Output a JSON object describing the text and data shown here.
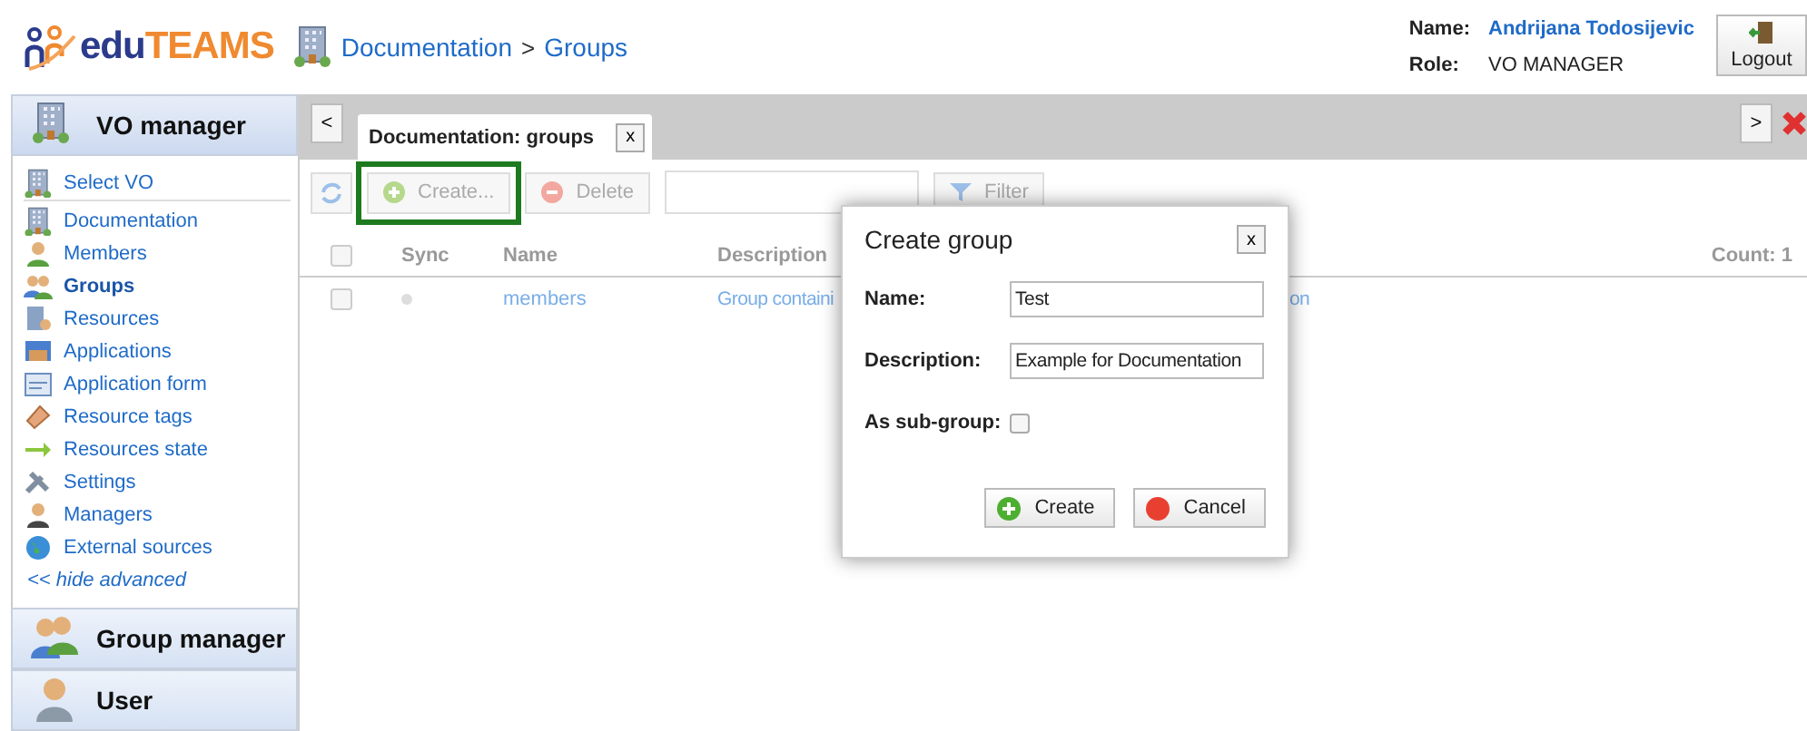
{
  "header": {
    "logo": {
      "part_1": "edu",
      "part_2": "TEAMS"
    },
    "breadcrumb": {
      "items": [
        "Documentation",
        "Groups"
      ],
      "separator": ">"
    },
    "user": {
      "name_label": "Name:",
      "name": "Andrijana Todosijevic",
      "role_label": "Role:",
      "role": "VO MANAGER"
    },
    "logout": "Logout"
  },
  "sidebar": {
    "sections": [
      {
        "title": "VO manager",
        "expanded": true,
        "items": [
          {
            "label": "Select VO",
            "selected": false
          },
          {
            "label": "Documentation",
            "selected": false
          },
          {
            "label": "Members",
            "selected": false
          },
          {
            "label": "Groups",
            "selected": true
          },
          {
            "label": "Resources",
            "selected": false
          },
          {
            "label": "Applications",
            "selected": false
          },
          {
            "label": "Application form",
            "selected": false
          },
          {
            "label": "Resource tags",
            "selected": false
          },
          {
            "label": "Resources state",
            "selected": false
          },
          {
            "label": "Settings",
            "selected": false
          },
          {
            "label": "Managers",
            "selected": false
          },
          {
            "label": "External sources",
            "selected": false
          }
        ],
        "toggle_link": "<< hide advanced"
      },
      {
        "title": "Group manager",
        "expanded": false
      },
      {
        "title": "User",
        "expanded": false
      }
    ]
  },
  "tab_bar": {
    "prev": "<",
    "next": ">",
    "tabs": [
      {
        "label": "Documentation: groups",
        "selected": true,
        "close": "x"
      }
    ]
  },
  "toolbar": {
    "create": {
      "label": "Create...",
      "highlighted": true
    },
    "delete": {
      "label": "Delete"
    },
    "filter": {
      "label": "Filter"
    }
  },
  "table": {
    "header_checked": false,
    "columns": [
      "Sync",
      "Name",
      "Description"
    ],
    "count": "Count: 1",
    "rows": [
      {
        "checked": false,
        "name": "members",
        "description": "Group containi",
        "description_tail": "on"
      }
    ]
  },
  "dialog": {
    "title": "Create group",
    "close": "x",
    "fields": [
      {
        "kind": "text",
        "label": "Name:",
        "value": "Test"
      },
      {
        "kind": "text",
        "label": "Description:",
        "value": "Example for Documentation"
      },
      {
        "kind": "checkbox",
        "label": "As sub-group:",
        "checked": false
      }
    ],
    "buttons": [
      {
        "kind": "create",
        "label": "Create"
      },
      {
        "kind": "cancel",
        "label": "Cancel"
      }
    ]
  }
}
